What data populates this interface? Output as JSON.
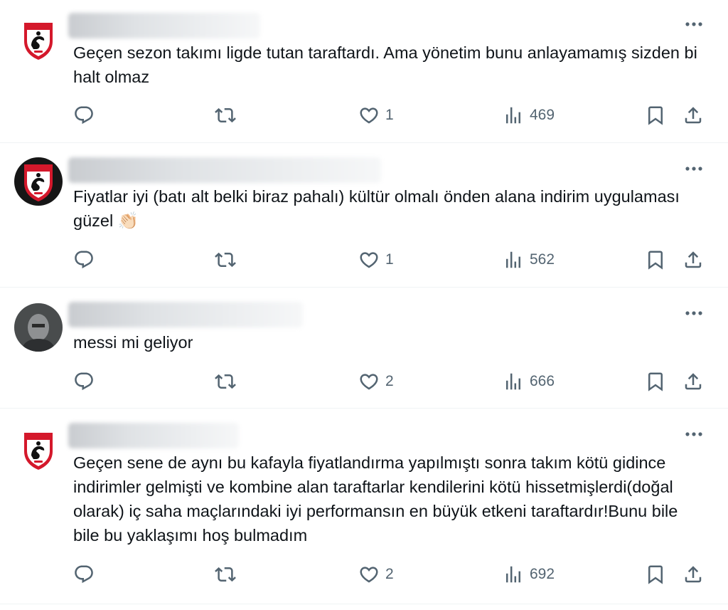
{
  "posts": [
    {
      "avatar": "samsunspor-logo",
      "text": "Geçen sezon takımı ligde tutan taraftardı. Ama yönetim bunu anlayamamış sizden bi halt olmaz",
      "likes": "1",
      "views": "469"
    },
    {
      "avatar": "samsunspor-logo-dark",
      "text": "Fiyatlar iyi (batı alt belki biraz pahalı) kültür olmalı önden alana indirim uygulaması güzel 👏🏻",
      "likes": "1",
      "views": "562"
    },
    {
      "avatar": "grayscale-portrait",
      "text": "messi mi geliyor",
      "likes": "2",
      "views": "666"
    },
    {
      "avatar": "samsunspor-logo",
      "text": "Geçen sene de aynı bu kafayla fiyatlandırma yapılmıştı sonra takım kötü gidince indirimler gelmişti ve kombine alan taraftarlar kendilerini kötü hissetmişlerdi(doğal olarak) iç saha maçlarındaki iyi performansın en büyük etkeni taraftardır!Bunu bile bile bu yaklaşımı hoş bulmadım",
      "likes": "2",
      "views": "692"
    }
  ],
  "icons": {
    "reply": "reply-icon",
    "retweet": "retweet-icon",
    "like": "heart-icon",
    "views": "views-chart-icon",
    "bookmark": "bookmark-icon",
    "share": "share-icon",
    "more": "more-dots-icon"
  },
  "colors": {
    "text": "#0f1419",
    "secondary": "#536471",
    "divider": "#eff3f4",
    "logo_red": "#d4182b"
  }
}
